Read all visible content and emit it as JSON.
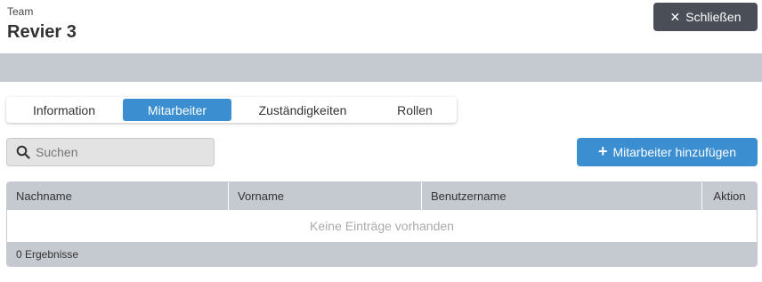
{
  "header": {
    "eyebrow": "Team",
    "title": "Revier 3",
    "close_label": "Schließen"
  },
  "tabs": [
    {
      "label": "Information",
      "active": false
    },
    {
      "label": "Mitarbeiter",
      "active": true
    },
    {
      "label": "Zuständigkeiten",
      "active": false
    },
    {
      "label": "Rollen",
      "active": false
    }
  ],
  "search": {
    "placeholder": "Suchen",
    "value": ""
  },
  "add_button": {
    "label": "Mitarbeiter hinzufügen"
  },
  "table": {
    "columns": [
      "Nachname",
      "Vorname",
      "Benutzername",
      "Aktion"
    ],
    "empty_message": "Keine Einträge vorhanden",
    "results_text": "0 Ergebnisse"
  },
  "icons": {
    "close": "close-icon",
    "search": "search-icon",
    "add": "plus-icon"
  },
  "colors": {
    "primary": "#3b8ed0",
    "dark_button": "#4a4e57",
    "band": "#c5c9d0"
  }
}
